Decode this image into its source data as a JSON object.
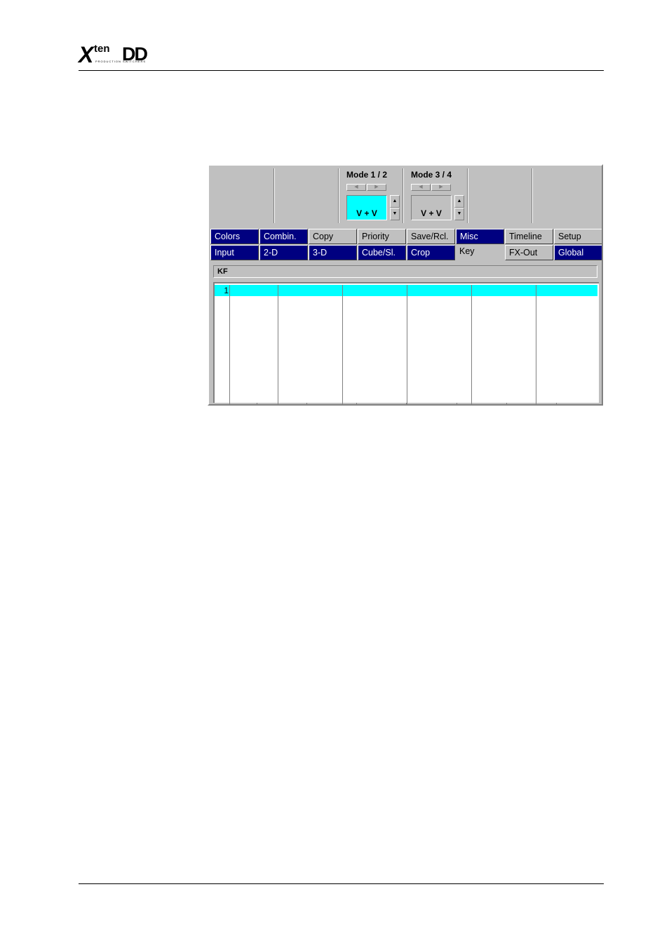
{
  "brand": {
    "mark_x": "X",
    "mark_ten": "ten",
    "mark_dd": "DD",
    "subtitle": "PRODUCTION SWITCHERS"
  },
  "panel": {
    "mode_1_2": {
      "title": "Mode 1 / 2",
      "value": "V + V",
      "highlighted": true
    },
    "mode_3_4": {
      "title": "Mode 3 / 4",
      "value": "V + V",
      "highlighted": false
    },
    "arrow_left": "◀",
    "arrow_right": "▶",
    "spin_up": "▲",
    "spin_down": "▼"
  },
  "tabs": {
    "row1": [
      "Colors",
      "Combin.",
      "Copy",
      "Priority",
      "Save/Rcl.",
      "Misc",
      "Timeline",
      "Setup"
    ],
    "row2": [
      "Input",
      "2-D",
      "3-D",
      "Cube/Sl.",
      "Crop",
      "Key",
      "FX-Out",
      "Global"
    ],
    "active": "Key"
  },
  "table": {
    "header": "KF",
    "rows": [
      {
        "index": "1",
        "selected": true
      }
    ]
  },
  "colors": {
    "tab_blue": "#000080",
    "selection": "#00ffff",
    "panel_grey": "#c0c0c0"
  }
}
